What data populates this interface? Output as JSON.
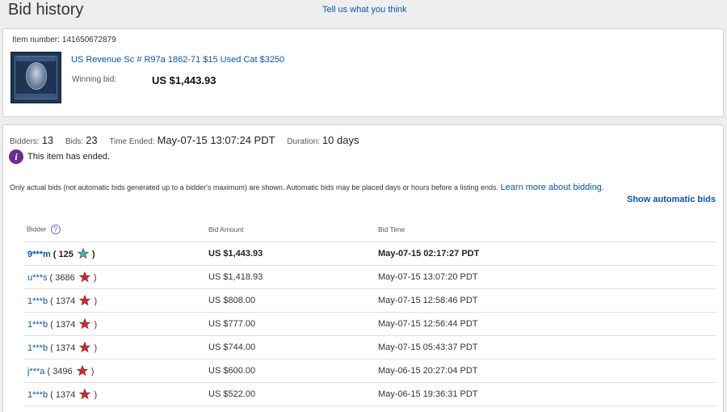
{
  "header": {
    "title": "Bid history",
    "feedback_link": "Tell us what you think"
  },
  "item": {
    "number_label": "Item number:",
    "number": "141650672879",
    "title": "US Revenue Sc # R97a 1862-71 $15 Used Cat $3250",
    "winning_bid_label": "Winning bid:",
    "winning_bid": "US $1,443.93"
  },
  "summary": {
    "bidders_label": "Bidders:",
    "bidders": "13",
    "bids_label": "Bids:",
    "bids": "23",
    "time_ended_label": "Time Ended:",
    "time_ended": "May-07-15 13:07:24 PDT",
    "duration_label": "Duration:",
    "duration": "10 days"
  },
  "status": {
    "icon": "info-icon",
    "message": "This item has ended."
  },
  "note": {
    "text": "Only actual bids (not automatic bids generated up to a bidder's maximum) are shown. Automatic bids may be placed days or hours before a listing ends.",
    "learn_more": "Learn more about bidding."
  },
  "show_automatic_bids": "Show automatic bids",
  "table": {
    "headers": [
      "Bidder",
      "Bid Amount",
      "Bid Time"
    ],
    "rows": [
      {
        "bidder": "9***m",
        "score": "125",
        "star": "turquoise",
        "amount": "US $1,443.93",
        "time": "May-07-15 02:17:27 PDT",
        "winner": true
      },
      {
        "bidder": "u***s",
        "score": "3686",
        "star": "red",
        "amount": "US $1,418.93",
        "time": "May-07-15 13:07:20 PDT",
        "winner": false
      },
      {
        "bidder": "1***b",
        "score": "1374",
        "star": "red",
        "amount": "US $808.00",
        "time": "May-07-15 12:58:46 PDT",
        "winner": false
      },
      {
        "bidder": "1***b",
        "score": "1374",
        "star": "red",
        "amount": "US $777.00",
        "time": "May-07-15 12:56:44 PDT",
        "winner": false
      },
      {
        "bidder": "1***b",
        "score": "1374",
        "star": "red",
        "amount": "US $744.00",
        "time": "May-07-15 05:43:37 PDT",
        "winner": false
      },
      {
        "bidder": "j***a",
        "score": "3496",
        "star": "red",
        "amount": "US $600.00",
        "time": "May-06-15 20:27:04 PDT",
        "winner": false
      },
      {
        "bidder": "1***b",
        "score": "1374",
        "star": "red",
        "amount": "US $522.00",
        "time": "May-06-15 19:36:31 PDT",
        "winner": false
      }
    ]
  },
  "colors": {
    "link": "#0654ba",
    "info_icon": "#6b2c91",
    "star_red": "#d9252a",
    "star_turquoise": "#2fc1b3"
  }
}
